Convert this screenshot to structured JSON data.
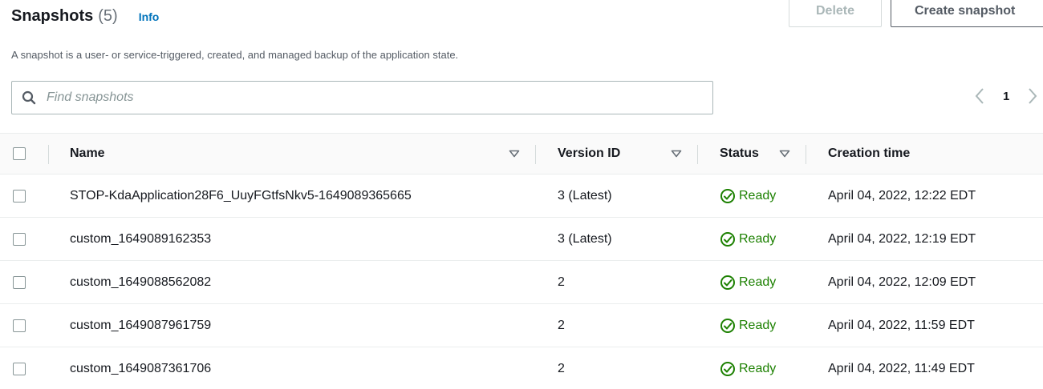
{
  "header": {
    "title": "Snapshots",
    "count": "(5)",
    "info_label": "Info",
    "description": "A snapshot is a user- or service-triggered, created, and managed backup of the application state."
  },
  "actions": {
    "delete_label": "Delete",
    "create_label": "Create snapshot"
  },
  "search": {
    "placeholder": "Find snapshots",
    "value": ""
  },
  "pagination": {
    "current_page": "1"
  },
  "table": {
    "columns": {
      "name": "Name",
      "version": "Version ID",
      "status": "Status",
      "time": "Creation time"
    },
    "rows": [
      {
        "name": "STOP-KdaApplication28F6_UuyFGtfsNkv5-1649089365665",
        "version": "3 (Latest)",
        "status": "Ready",
        "time": "April 04, 2022, 12:22 EDT"
      },
      {
        "name": "custom_1649089162353",
        "version": "3 (Latest)",
        "status": "Ready",
        "time": "April 04, 2022, 12:19 EDT"
      },
      {
        "name": "custom_1649088562082",
        "version": "2",
        "status": "Ready",
        "time": "April 04, 2022, 12:09 EDT"
      },
      {
        "name": "custom_1649087961759",
        "version": "2",
        "status": "Ready",
        "time": "April 04, 2022, 11:59 EDT"
      },
      {
        "name": "custom_1649087361706",
        "version": "2",
        "status": "Ready",
        "time": "April 04, 2022, 11:49 EDT"
      }
    ]
  },
  "colors": {
    "link": "#0073bb",
    "success": "#1d8102",
    "text": "#16191f",
    "muted": "#545b64"
  },
  "icons": {
    "search": "search-icon",
    "sort": "caret-down-icon",
    "status_ready": "check-circle-icon",
    "prev": "chevron-left-icon",
    "next": "chevron-right-icon"
  }
}
